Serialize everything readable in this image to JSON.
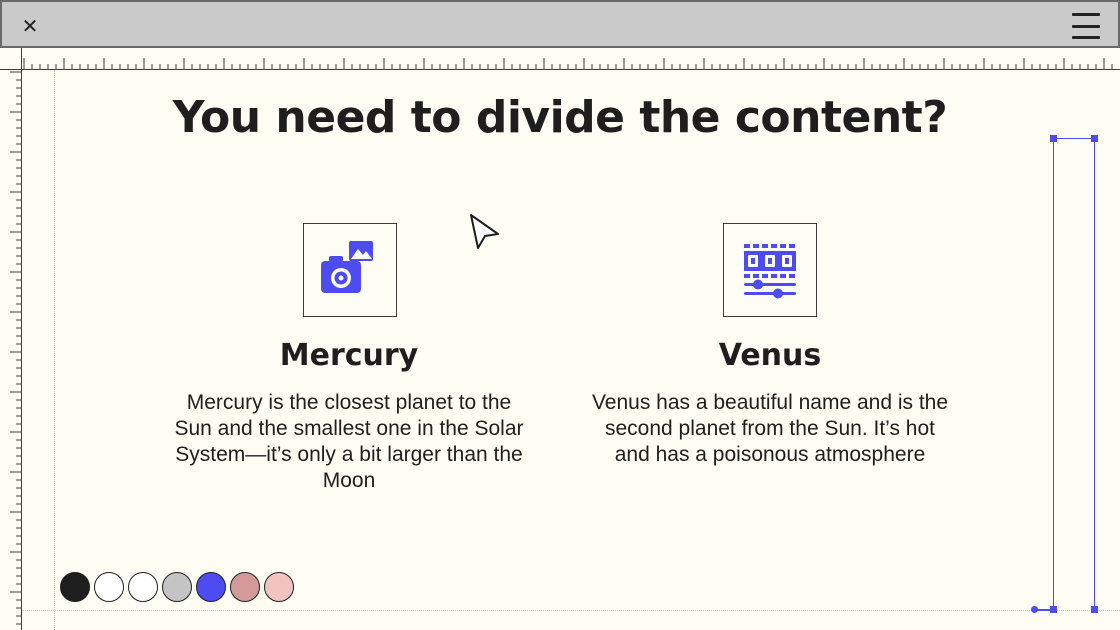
{
  "window": {
    "close_glyph": "✕"
  },
  "slide": {
    "headline": "You need to divide the content?",
    "cards": [
      {
        "title": "Mercury",
        "icon": "camera-with-image-icon",
        "text": "Mercury is the closest planet to the Sun and the smallest one in the Solar System—it’s only a bit larger than the Moon"
      },
      {
        "title": "Venus",
        "icon": "video-editor-icon",
        "text": "Venus has a beautiful name and is the second planet from the Sun. It’s hot and has a poisonous atmosphere"
      }
    ]
  },
  "palette": [
    {
      "name": "black",
      "color": "#1e1e1e"
    },
    {
      "name": "white",
      "color": "#ffffff"
    },
    {
      "name": "white-2",
      "color": "#ffffff"
    },
    {
      "name": "gray",
      "color": "#c4c4c4"
    },
    {
      "name": "blue",
      "color": "#4c4cf0"
    },
    {
      "name": "rose",
      "color": "#d49a9a"
    },
    {
      "name": "pink",
      "color": "#f2c4c0"
    }
  ],
  "colors": {
    "accent": "#4c4cf0",
    "background": "#fdfdf3",
    "ink": "#1e1e1e"
  }
}
